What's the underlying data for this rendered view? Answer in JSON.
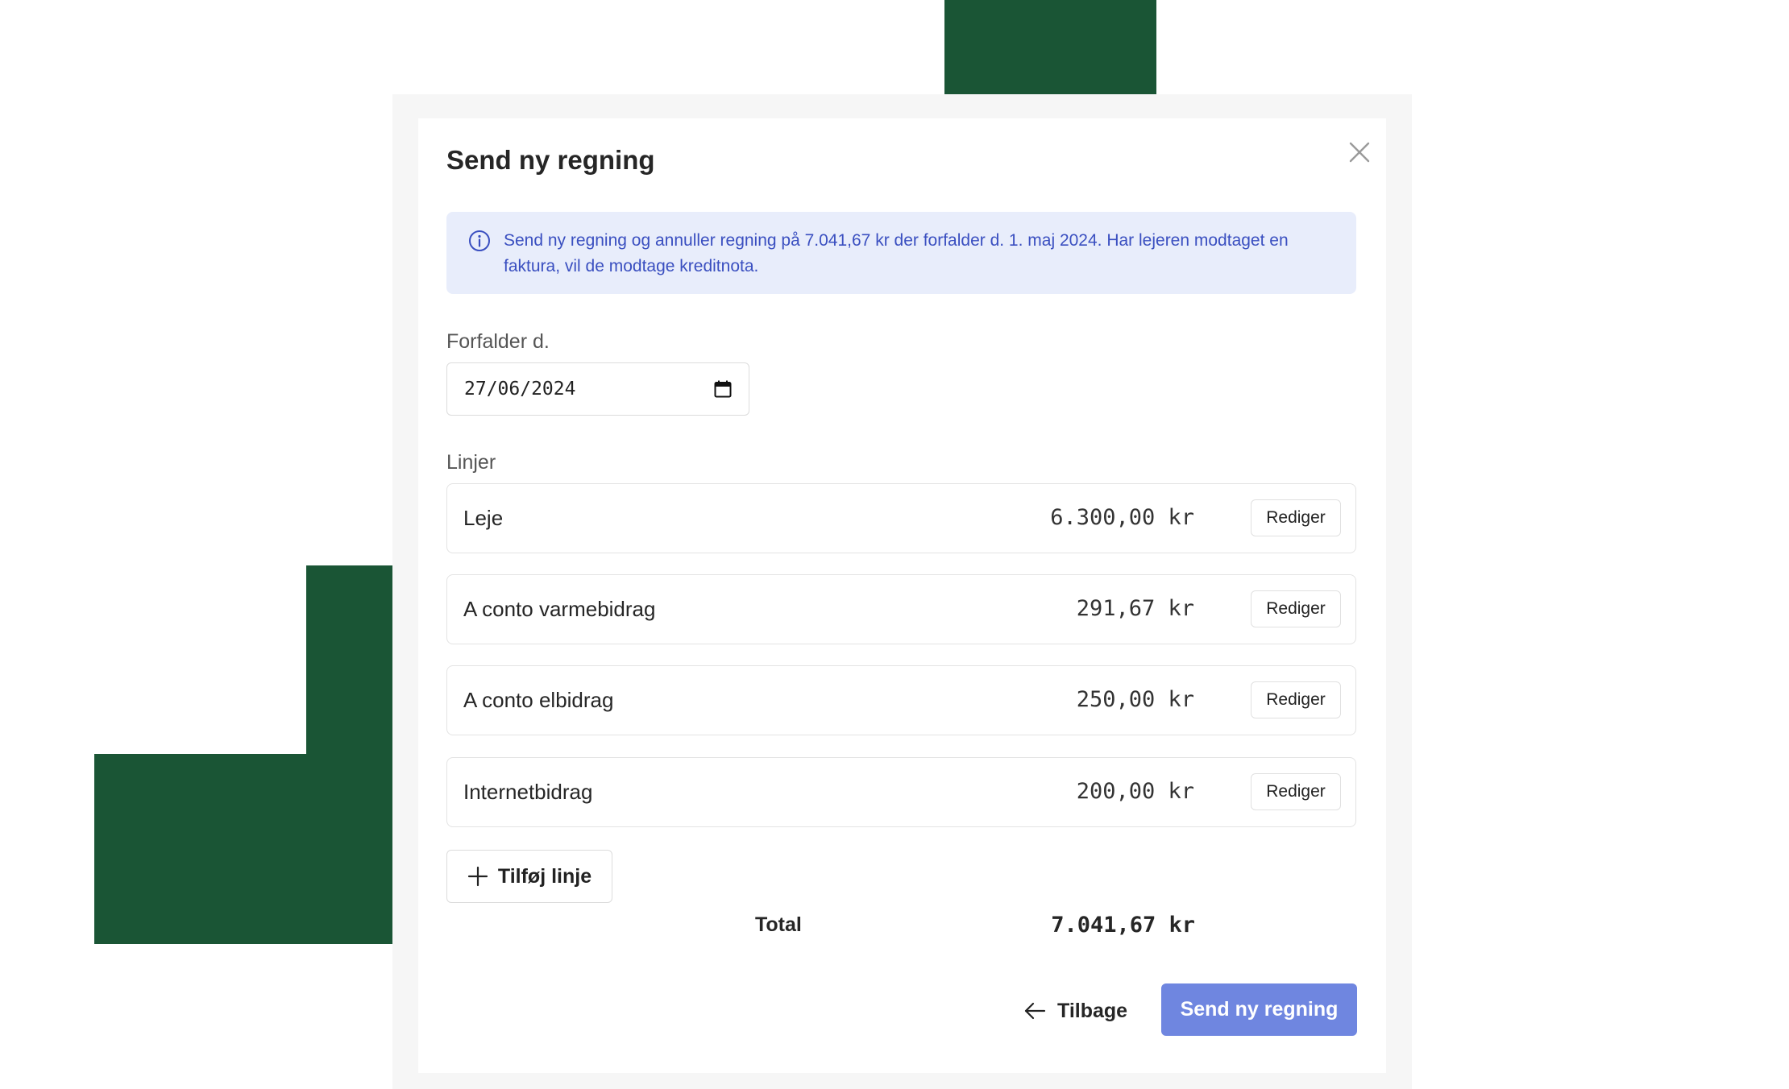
{
  "modal": {
    "title": "Send ny regning",
    "info_text": "Send ny regning og annuller regning på 7.041,67 kr der forfalder d. 1. maj 2024. Har lejeren modtaget en faktura, vil de modtage kreditnota.",
    "due_label": "Forfalder d.",
    "due_value": "27/06/2024",
    "lines_label": "Linjer",
    "lines": [
      {
        "name": "Leje",
        "amount": "6.300,00 kr",
        "edit_label": "Rediger"
      },
      {
        "name": "A conto varmebidrag",
        "amount": "291,67 kr",
        "edit_label": "Rediger"
      },
      {
        "name": "A conto elbidrag",
        "amount": "250,00 kr",
        "edit_label": "Rediger"
      },
      {
        "name": "Internetbidrag",
        "amount": "200,00 kr",
        "edit_label": "Rediger"
      }
    ],
    "add_line_label": "Tilføj linje",
    "total_label": "Total",
    "total_value": "7.041,67 kr",
    "back_label": "Tilbage",
    "send_label": "Send ny regning"
  },
  "colors": {
    "accent": "#6f86e0",
    "info_bg": "#e8edfb",
    "info_text": "#3a4fc0",
    "decor_green": "#1a5535"
  },
  "icons": {
    "close": "close-icon",
    "info": "info-icon",
    "calendar": "calendar-icon",
    "add": "plus-icon",
    "back": "arrow-left-icon"
  }
}
